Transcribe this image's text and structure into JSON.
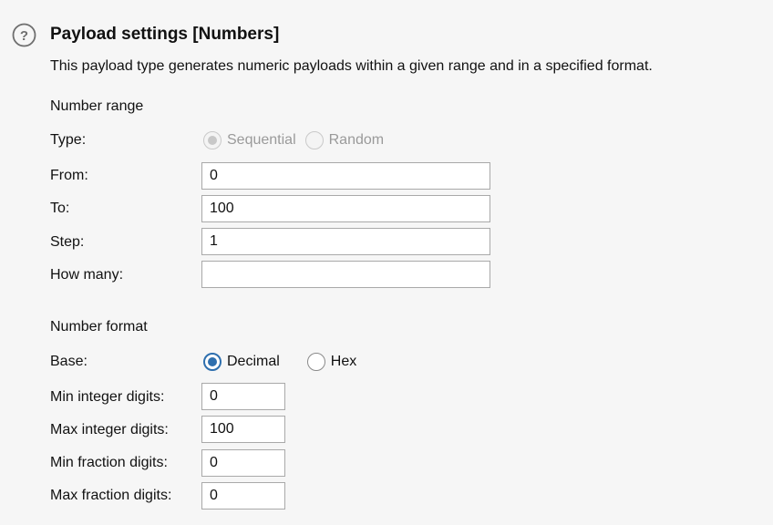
{
  "header": {
    "title": "Payload settings [Numbers]",
    "description": "This payload type generates numeric payloads within a given range and in a specified format."
  },
  "number_range": {
    "section_label": "Number range",
    "type_label": "Type:",
    "type_options": [
      {
        "label": "Sequential",
        "selected": true,
        "disabled": true
      },
      {
        "label": "Random",
        "selected": false,
        "disabled": true
      }
    ],
    "from_label": "From:",
    "from_value": "0",
    "to_label": "To:",
    "to_value": "100",
    "step_label": "Step:",
    "step_value": "1",
    "how_many_label": "How many:",
    "how_many_value": ""
  },
  "number_format": {
    "section_label": "Number format",
    "base_label": "Base:",
    "base_options": [
      {
        "label": "Decimal",
        "selected": true
      },
      {
        "label": "Hex",
        "selected": false
      }
    ],
    "min_integer_label": "Min integer digits:",
    "min_integer_value": "0",
    "max_integer_label": "Max integer digits:",
    "max_integer_value": "100",
    "min_fraction_label": "Min fraction digits:",
    "min_fraction_value": "0",
    "max_fraction_label": "Max fraction digits:",
    "max_fraction_value": "0"
  },
  "colors": {
    "accent": "#2e6fae",
    "background": "#f6f6f6",
    "input_border": "#a9a9a9",
    "disabled_text": "#9a9a9a"
  },
  "icons": {
    "help": "help-icon"
  }
}
